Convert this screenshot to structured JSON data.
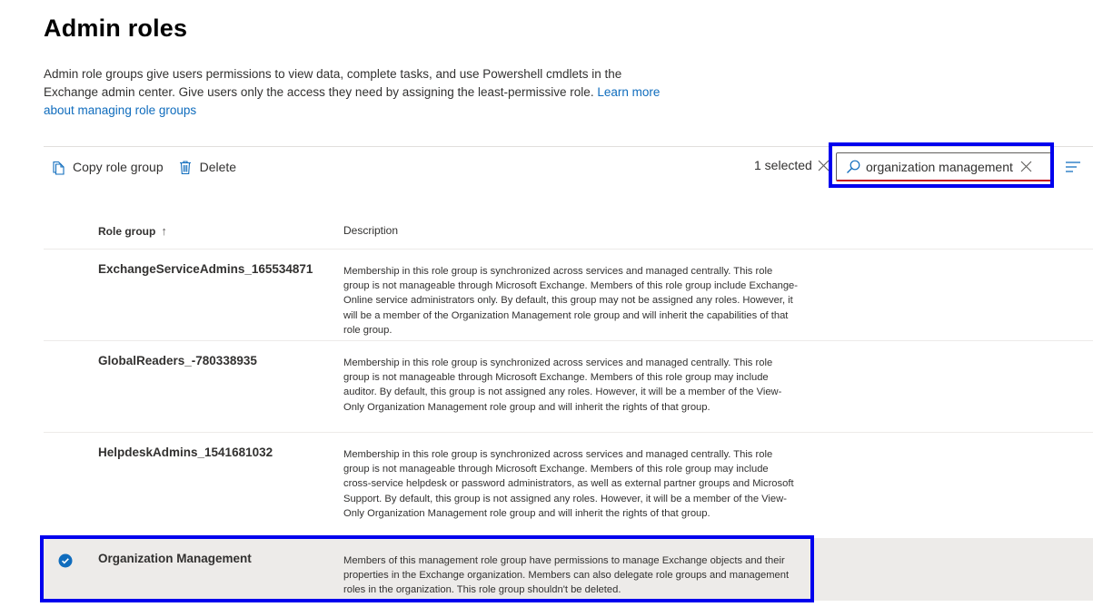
{
  "page": {
    "title": "Admin roles",
    "intro_text": "Admin role groups give users permissions to view data, complete tasks, and use Powershell cmdlets in the Exchange admin center. Give users only the access they need by assigning the least-permissive role. ",
    "learn_more_link": "Learn more about managing role groups"
  },
  "toolbar": {
    "copy_label": "Copy role group",
    "copy_icon": "copy-icon",
    "delete_label": "Delete",
    "delete_icon": "trash-icon",
    "selected_count": "1 selected",
    "clear_selection_icon": "close-icon"
  },
  "search": {
    "value": "organization management",
    "search_icon": "search-icon",
    "clear_icon": "close-icon"
  },
  "filter_icon": "filter-lines-icon",
  "table": {
    "columns": [
      {
        "label": "Role group",
        "sort": "ascending",
        "sort_icon": "arrow-up-icon"
      },
      {
        "label": "Description"
      }
    ],
    "rows": [
      {
        "name": "ExchangeServiceAdmins_165534871",
        "description": "Membership in this role group is synchronized across services and managed centrally. This role group is not manageable through Microsoft Exchange. Members of this role group include Exchange-Online service administrators only. By default, this group may not be assigned any roles. However, it will be a member of the Organization Management role group and will inherit the capabilities of that role group.",
        "selected": false
      },
      {
        "name": "GlobalReaders_-780338935",
        "description": "Membership in this role group is synchronized across services and managed centrally. This role group is not manageable through Microsoft Exchange. Members of this role group may include auditor. By default, this group is not assigned any roles. However, it will be a member of the View-Only Organization Management role group and will inherit the rights of that group.",
        "selected": false
      },
      {
        "name": "HelpdeskAdmins_1541681032",
        "description": "Membership in this role group is synchronized across services and managed centrally. This role group is not manageable through Microsoft Exchange. Members of this role group may include cross-service helpdesk or password administrators, as well as external partner groups and Microsoft Support. By default, this group is not assigned any roles. However, it will be a member of the View-Only Organization Management role group and will inherit the rights of that group.",
        "selected": false
      },
      {
        "name": "Organization Management",
        "description": "Members of this management role group have permissions to manage Exchange objects and their properties in the Exchange organization. Members can also delegate role groups and management roles in the organization. This role group shouldn't be deleted.",
        "selected": true
      }
    ]
  },
  "colors": {
    "accent": "#0f6cbd",
    "highlight_border": "#0000ee",
    "selected_row_bg": "#edebe9",
    "search_underline": "#c50f1f"
  }
}
